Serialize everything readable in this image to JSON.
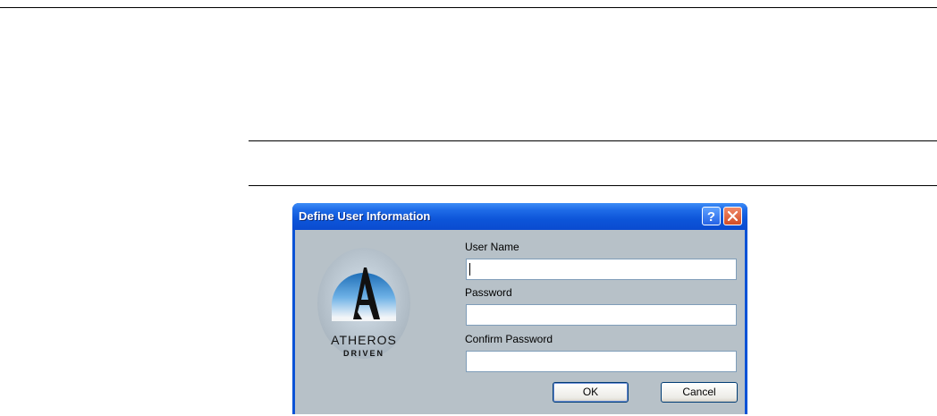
{
  "dialog": {
    "title": "Define User Information",
    "logo": {
      "brand_text_1": "ATHEROS",
      "brand_text_2": "DRIVEN"
    },
    "fields": {
      "user_name_label": "User Name",
      "user_name_value": "",
      "password_label": "Password",
      "password_value": "",
      "confirm_label": "Confirm Password",
      "confirm_value": ""
    },
    "buttons": {
      "ok": "OK",
      "cancel": "Cancel"
    },
    "titlebar_buttons": {
      "help": "help-icon",
      "close": "close-icon"
    }
  },
  "colors": {
    "titlebar": "#0a52d6",
    "client_bg": "#b7c1c8",
    "close_button": "#d24d26",
    "help_button": "#2563e6"
  }
}
